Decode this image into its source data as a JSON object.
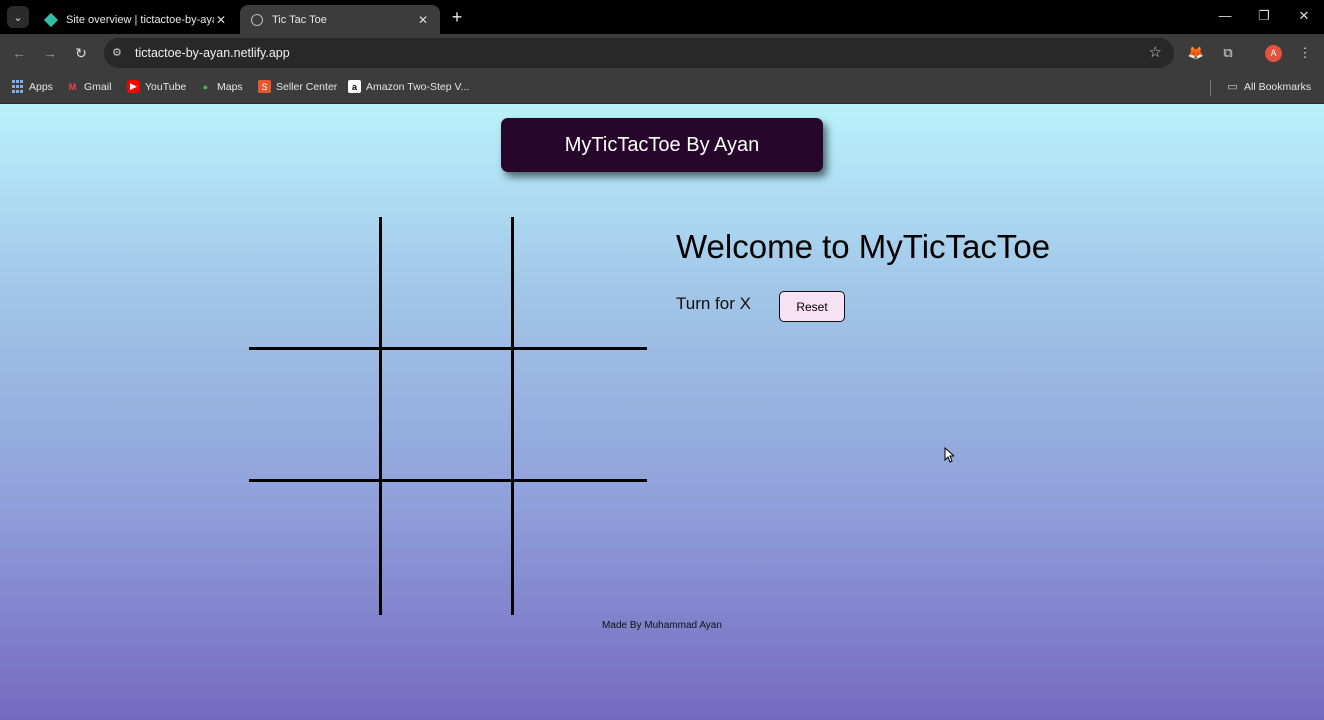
{
  "browser": {
    "tabs": [
      {
        "title": "Site overview | tictactoe-by-ayan",
        "close": "✕"
      },
      {
        "title": "Tic Tac Toe",
        "close": "✕"
      }
    ],
    "new_tab": "+",
    "window_controls": {
      "minimize": "—",
      "restore": "❐",
      "close": "✕"
    },
    "url": "tictactoe-by-ayan.netlify.app",
    "profile_initial": "A",
    "bookmarks": [
      {
        "label": "Apps",
        "icon": "apps-grid-icon"
      },
      {
        "label": "Gmail",
        "icon": "gmail-icon"
      },
      {
        "label": "YouTube",
        "icon": "youtube-icon"
      },
      {
        "label": "Maps",
        "icon": "maps-pin-icon"
      },
      {
        "label": "Seller Center",
        "icon": "seller-center-icon"
      },
      {
        "label": "Amazon Two-Step V...",
        "icon": "amazon-icon"
      }
    ],
    "all_bookmarks": "All Bookmarks"
  },
  "app": {
    "brand": "MyTicTacToe By Ayan",
    "welcome": "Welcome to MyTicTacToe",
    "turn_text": "Turn for X",
    "reset_label": "Reset",
    "board": [
      "",
      "",
      "",
      "",
      "",
      "",
      "",
      "",
      ""
    ],
    "footer": "Made By Muhammad Ayan"
  }
}
